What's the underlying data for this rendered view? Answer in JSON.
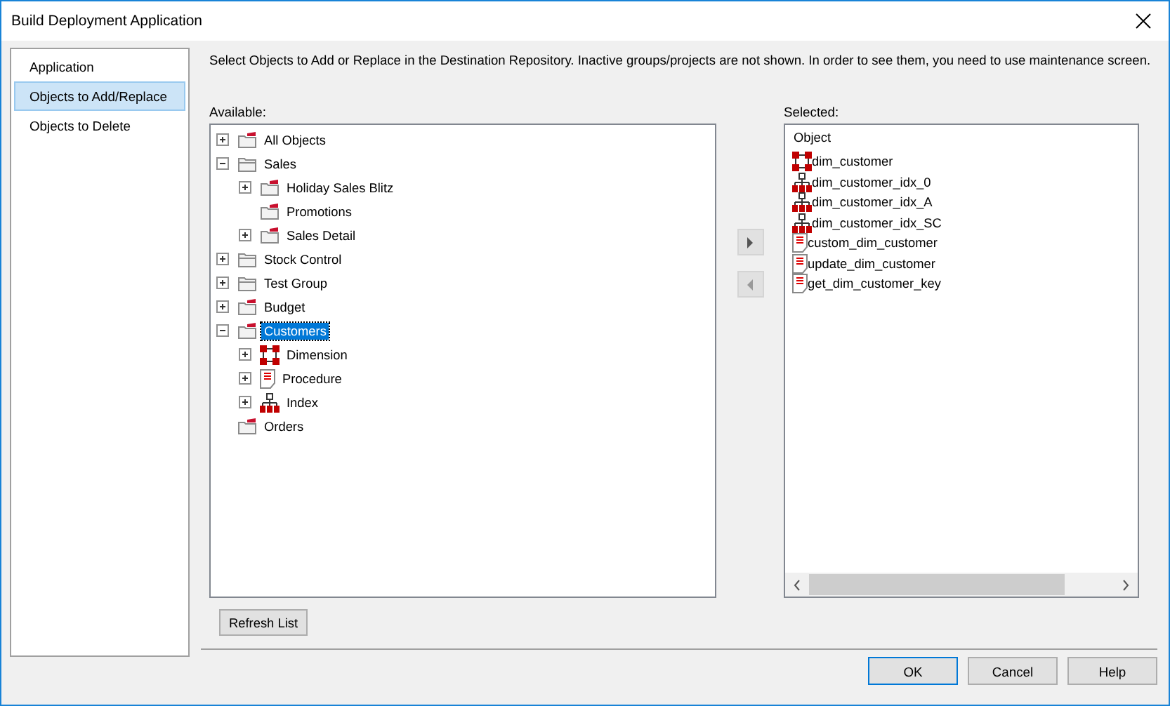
{
  "window": {
    "title": "Build Deployment Application"
  },
  "nav": [
    {
      "label": "Application",
      "selected": false
    },
    {
      "label": "Objects to Add/Replace",
      "selected": true
    },
    {
      "label": "Objects to Delete",
      "selected": false
    }
  ],
  "instructions": "Select Objects to Add or Replace in the Destination Repository. Inactive groups/projects are not shown. In order to see them, you need to use maintenance screen.",
  "available": {
    "label": "Available:",
    "tree": [
      {
        "label": "All Objects",
        "kind": "project",
        "expanded": false,
        "selected": false
      },
      {
        "label": "Sales",
        "kind": "group",
        "expanded": true,
        "selected": false,
        "children": [
          {
            "label": "Holiday Sales Blitz",
            "kind": "project",
            "expanded": false,
            "selected": false
          },
          {
            "label": "Promotions",
            "kind": "project",
            "selected": false
          },
          {
            "label": "Sales Detail",
            "kind": "project",
            "expanded": false,
            "selected": false
          }
        ]
      },
      {
        "label": "Stock Control",
        "kind": "group",
        "expanded": false,
        "selected": false
      },
      {
        "label": "Test Group",
        "kind": "group",
        "expanded": false,
        "selected": false
      },
      {
        "label": "Budget",
        "kind": "project",
        "expanded": false,
        "selected": false
      },
      {
        "label": "Customers",
        "kind": "project",
        "expanded": true,
        "selected": true,
        "children": [
          {
            "label": "Dimension",
            "kind": "dimension",
            "expanded": false,
            "selected": false
          },
          {
            "label": "Procedure",
            "kind": "procedure",
            "expanded": false,
            "selected": false
          },
          {
            "label": "Index",
            "kind": "index",
            "expanded": false,
            "selected": false
          }
        ]
      },
      {
        "label": "Orders",
        "kind": "project",
        "selected": false
      }
    ]
  },
  "selected": {
    "label": "Selected:",
    "header": "Object",
    "items": [
      {
        "label": "dim_customer",
        "kind": "dimension"
      },
      {
        "label": "dim_customer_idx_0",
        "kind": "index"
      },
      {
        "label": "dim_customer_idx_A",
        "kind": "index"
      },
      {
        "label": "dim_customer_idx_SC",
        "kind": "index"
      },
      {
        "label": "custom_dim_customer",
        "kind": "procedure"
      },
      {
        "label": "update_dim_customer",
        "kind": "procedure"
      },
      {
        "label": "get_dim_customer_key",
        "kind": "procedure"
      }
    ]
  },
  "transfer_buttons": [
    {
      "kind": "add"
    },
    {
      "kind": "remove"
    }
  ],
  "refresh_button": "Refresh List",
  "buttons": [
    {
      "label": "OK",
      "selected": true
    },
    {
      "label": "Cancel",
      "selected": false
    },
    {
      "label": "Help",
      "selected": false
    }
  ]
}
